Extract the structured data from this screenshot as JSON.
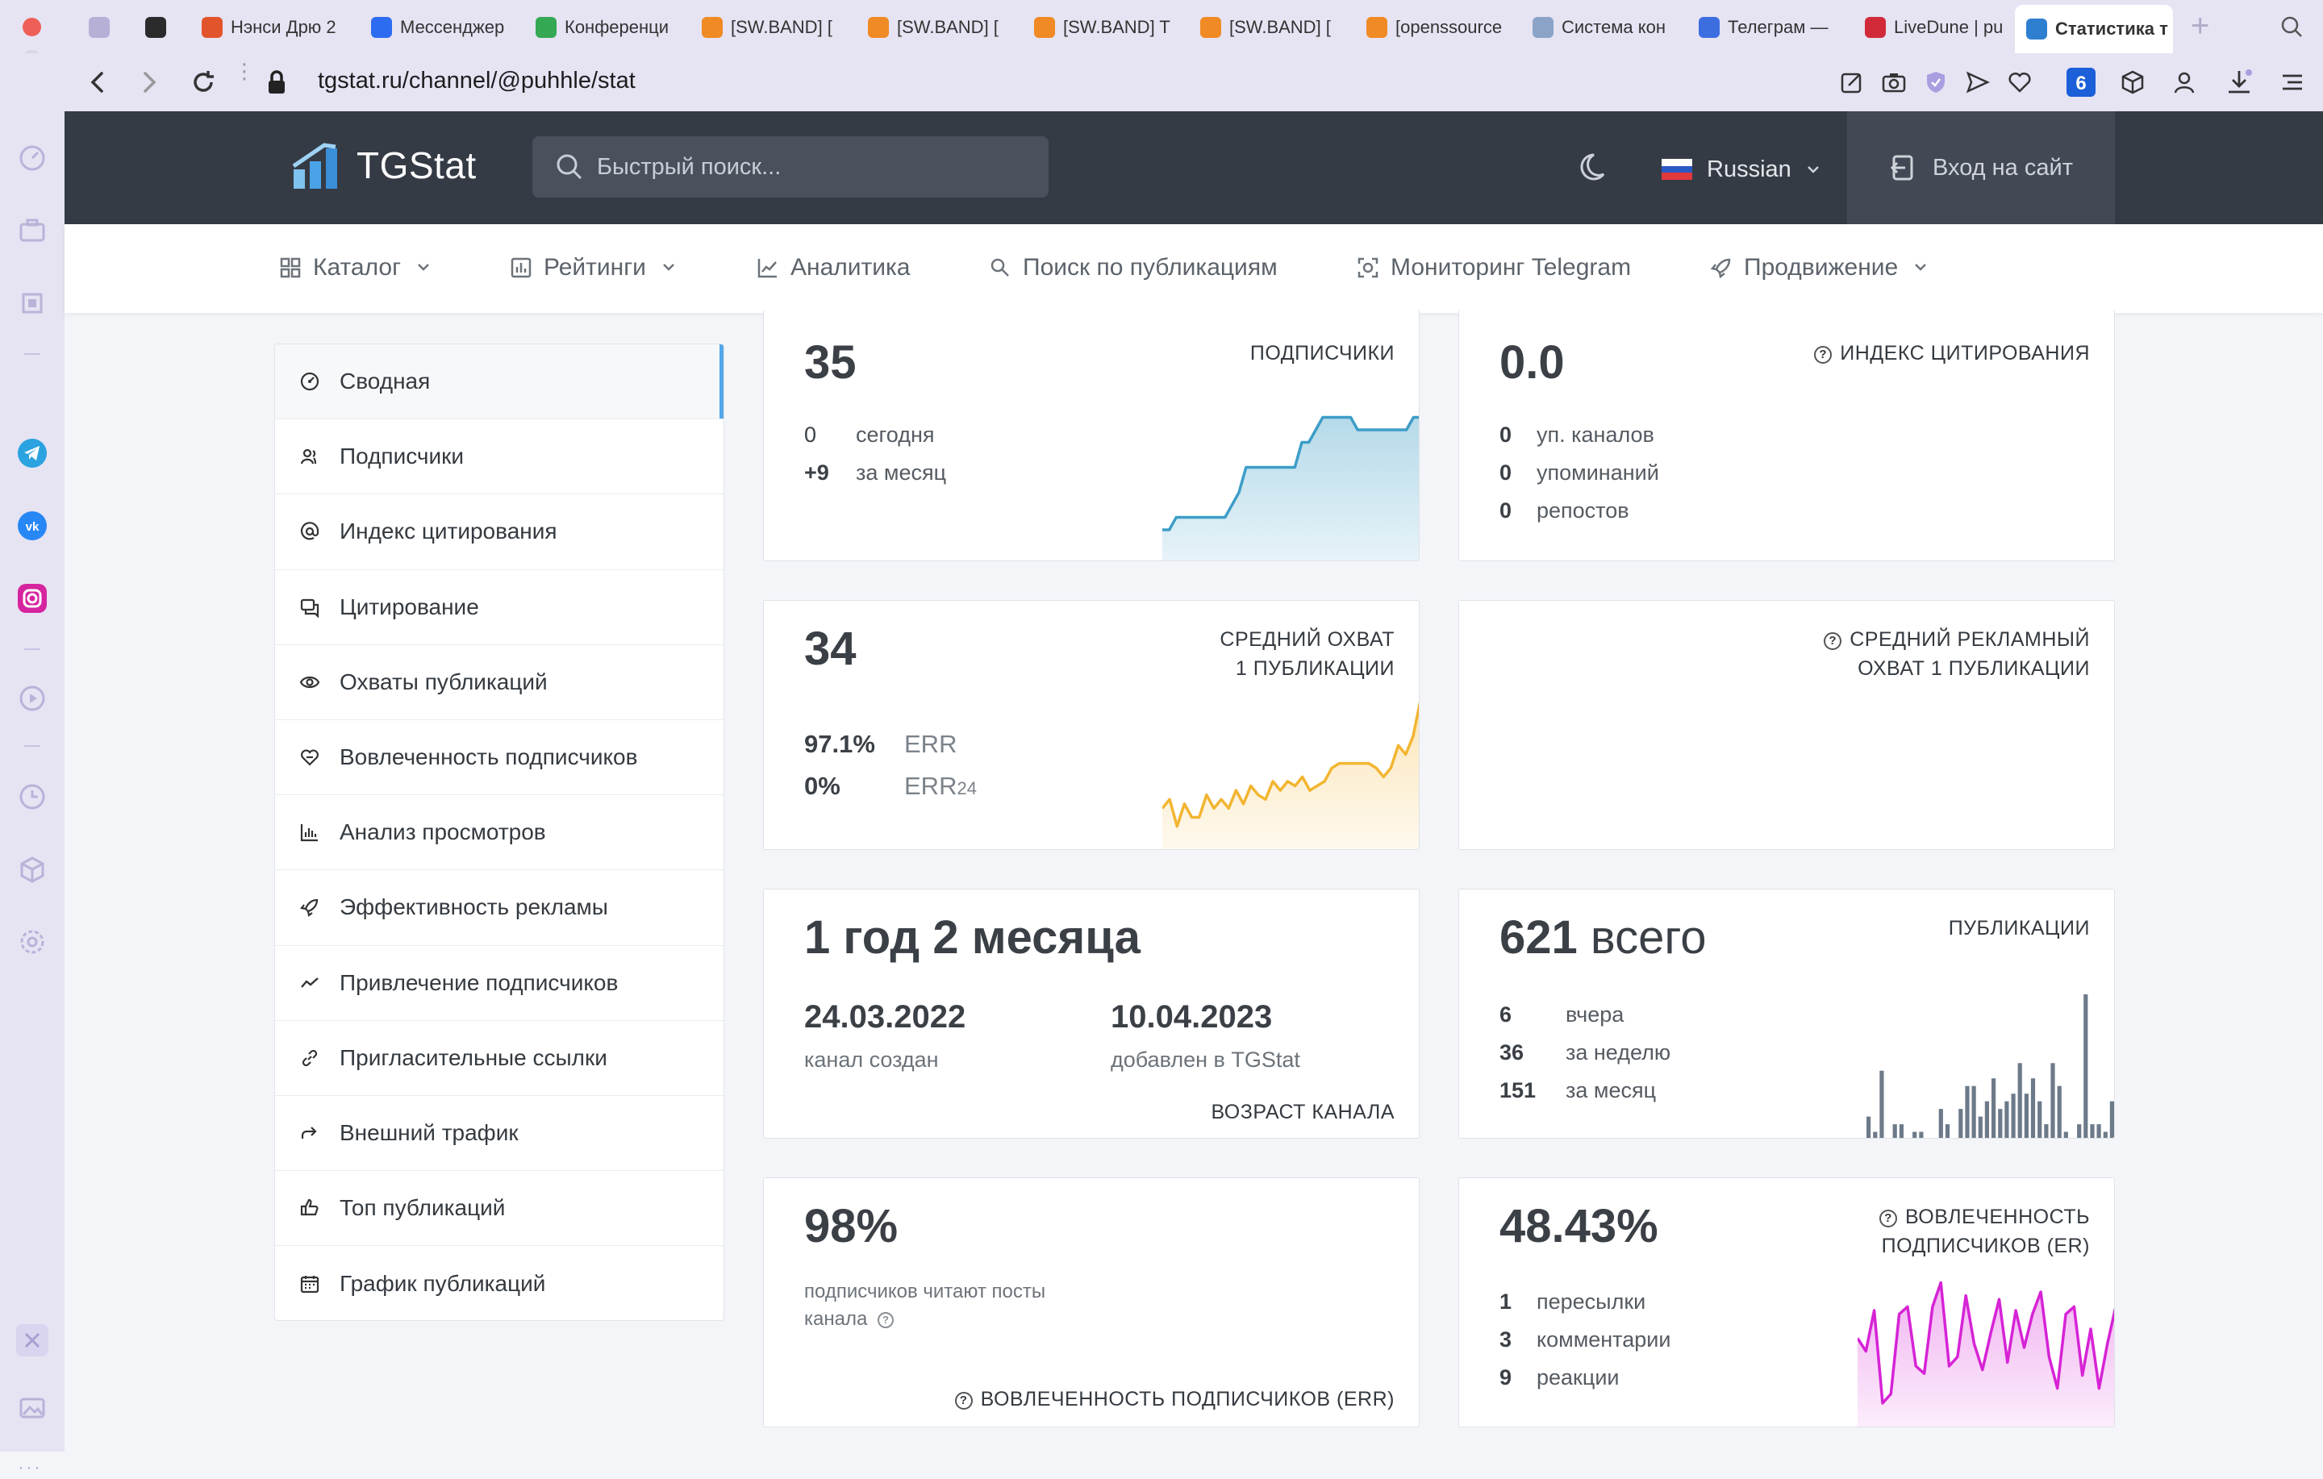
{
  "browser": {
    "tabs": [
      {
        "label": "",
        "icon": "gamepad-icon",
        "color": "#b7b0d6"
      },
      {
        "label": "",
        "icon": "gc-icon",
        "color": "#2b2b2b"
      },
      {
        "label": "Нэнси Дрю 2",
        "icon": "z-icon",
        "color": "#e2542c"
      },
      {
        "label": "Мессенджер",
        "icon": "messenger-icon",
        "color": "#2d6cf0"
      },
      {
        "label": "Конференци",
        "icon": "drive-icon",
        "color": "#34a853"
      },
      {
        "label": "[SW.BAND] [",
        "icon": "sw-icon",
        "color": "#f08a24"
      },
      {
        "label": "[SW.BAND] [",
        "icon": "sw-icon",
        "color": "#f08a24"
      },
      {
        "label": "[SW.BAND] T",
        "icon": "sw-icon",
        "color": "#f08a24"
      },
      {
        "label": "[SW.BAND] [",
        "icon": "sw-icon",
        "color": "#f08a24"
      },
      {
        "label": "[openssource",
        "icon": "sw-icon",
        "color": "#f08a24"
      },
      {
        "label": "Система кон",
        "icon": "pcb-icon",
        "color": "#8aa3c7"
      },
      {
        "label": "Телеграм —",
        "icon": "telegram-wing-icon",
        "color": "#3d6ee0"
      },
      {
        "label": "LiveDune | pu",
        "icon": "livedune-icon",
        "color": "#d12b3a"
      },
      {
        "label": "Статистика т",
        "icon": "tgstat-icon",
        "color": "#2f7fd1"
      }
    ],
    "url": "tgstat.ru/channel/@puhhle/stat"
  },
  "header": {
    "logo": "TGStat",
    "search_placeholder": "Быстрый поиск...",
    "language": "Russian",
    "login": "Вход на сайт"
  },
  "nav": [
    {
      "label": "Каталог",
      "icon": "grid-icon",
      "dropdown": true
    },
    {
      "label": "Рейтинги",
      "icon": "bar-chart-icon",
      "dropdown": true
    },
    {
      "label": "Аналитика",
      "icon": "line-chart-icon",
      "dropdown": false
    },
    {
      "label": "Поиск по публикациям",
      "icon": "search-icon",
      "dropdown": false
    },
    {
      "label": "Мониторинг Telegram",
      "icon": "monitor-icon",
      "dropdown": false
    },
    {
      "label": "Продвижение",
      "icon": "rocket-icon",
      "dropdown": true
    }
  ],
  "menu": [
    {
      "label": "Сводная",
      "icon": "dashboard-icon",
      "active": true
    },
    {
      "label": "Подписчики",
      "icon": "users-icon"
    },
    {
      "label": "Индекс цитирования",
      "icon": "at-icon"
    },
    {
      "label": "Цитирование",
      "icon": "quote-icon"
    },
    {
      "label": "Охваты публикаций",
      "icon": "eye-icon"
    },
    {
      "label": "Вовлеченность подписчиков",
      "icon": "engagement-icon"
    },
    {
      "label": "Анализ просмотров",
      "icon": "views-chart-icon"
    },
    {
      "label": "Эффективность рекламы",
      "icon": "rocket-icon"
    },
    {
      "label": "Привлечение подписчиков",
      "icon": "trend-icon"
    },
    {
      "label": "Пригласительные ссылки",
      "icon": "link-icon"
    },
    {
      "label": "Внешний трафик",
      "icon": "share-icon"
    },
    {
      "label": "Топ публикаций",
      "icon": "thumbs-up-icon"
    },
    {
      "label": "График публикаций",
      "icon": "calendar-icon"
    }
  ],
  "cards": {
    "subscribers": {
      "value": "35",
      "label": "ПОДПИСЧИКИ",
      "today_num": "0",
      "today_label": "сегодня",
      "month_num": "+9",
      "month_label": "за месяц",
      "chart": [
        26,
        26,
        27,
        27,
        27,
        27,
        27,
        27,
        27,
        27,
        28,
        29,
        31,
        31,
        31,
        31,
        31,
        31,
        31,
        31,
        33,
        33,
        34,
        35,
        35,
        35,
        35,
        35,
        34,
        34,
        34,
        34,
        34,
        34,
        34,
        34,
        35,
        35
      ]
    },
    "citation": {
      "value": "0.0",
      "label": "ИНДЕКС ЦИТИРОВАНИЯ",
      "rows": [
        {
          "num": "0",
          "label": "уп. каналов"
        },
        {
          "num": "0",
          "label": "упоминаний"
        },
        {
          "num": "0",
          "label": "репостов"
        }
      ]
    },
    "reach": {
      "value": "34",
      "label_line1": "СРЕДНИЙ ОХВАТ",
      "label_line2": "1 ПУБЛИКАЦИИ",
      "err_num": "97.1%",
      "err_label": "ERR",
      "err24_num": "0%",
      "err24_label": "ERR",
      "err24_sub": "24",
      "chart": [
        20,
        22,
        16,
        21,
        18,
        18,
        23,
        20,
        22,
        20,
        24,
        21,
        25,
        23,
        22,
        26,
        24,
        26,
        25,
        27,
        24,
        25,
        26,
        29,
        30,
        30,
        30,
        30,
        30,
        29,
        27,
        29,
        34,
        32,
        36,
        44
      ]
    },
    "ad_reach": {
      "label_line1": "СРЕДНИЙ РЕКЛАМНЫЙ",
      "label_line2": "ОХВАТ 1 ПУБЛИКАЦИИ"
    },
    "age": {
      "value": "1 год 2 месяца",
      "created_date": "24.03.2022",
      "created_label": "канал создан",
      "added_date": "10.04.2023",
      "added_label": "добавлен в TGStat",
      "footer": "ВОЗРАСТ КАНАЛА"
    },
    "posts": {
      "value_num": "621",
      "value_text": "всего",
      "label": "ПУБЛИКАЦИИ",
      "rows": [
        {
          "num": "6",
          "label": "вчера"
        },
        {
          "num": "36",
          "label": "за неделю"
        },
        {
          "num": "151",
          "label": "за месяц"
        }
      ],
      "chart": [
        3,
        1,
        9,
        0,
        2,
        2,
        0,
        1,
        1,
        0,
        0,
        4,
        2,
        0,
        4,
        7,
        7,
        3,
        5,
        8,
        4,
        5,
        6,
        10,
        6,
        8,
        5,
        2,
        10,
        7,
        1,
        0,
        2,
        19,
        2,
        2,
        1,
        5
      ]
    },
    "read_share": {
      "value": "98%",
      "text_line1": "подписчиков читают посты",
      "text_line2": "канала",
      "footer": "ВОВЛЕЧЕННОСТЬ ПОДПИСЧИКОВ (ERR)"
    },
    "er": {
      "value": "48.43%",
      "label_line1": "ВОВЛЕЧЕННОСТЬ",
      "label_line2": "ПОДПИСЧИКОВ (ER)",
      "rows": [
        {
          "num": "1",
          "label": "пересылки"
        },
        {
          "num": "3",
          "label": "комментарии"
        },
        {
          "num": "9",
          "label": "реакции"
        }
      ],
      "chart": [
        55,
        48,
        70,
        20,
        25,
        68,
        72,
        40,
        36,
        72,
        85,
        40,
        45,
        78,
        52,
        38,
        58,
        76,
        42,
        70,
        50,
        68,
        80,
        45,
        28,
        68,
        72,
        35,
        60,
        28,
        52,
        72
      ]
    }
  },
  "colors": {
    "header": "#353b45",
    "subscribers_line": "#3d9dc7",
    "reach_line": "#f2b531",
    "posts_bar": "#6c7a89",
    "er_line": "#d623d6",
    "active_marker": "#51a7e8",
    "positive": "#4cb87a"
  }
}
